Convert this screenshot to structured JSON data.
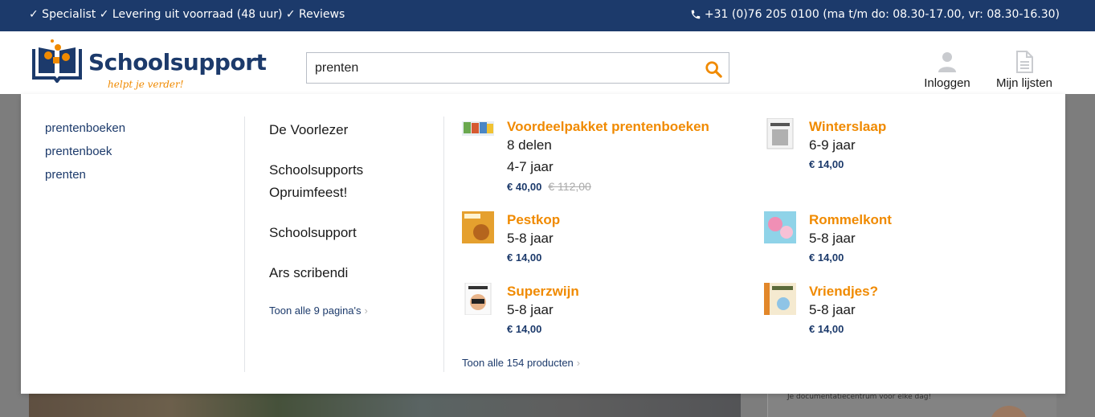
{
  "topbar": {
    "usps": "✓ Specialist ✓ Levering uit voorraad (48 uur) ✓ Reviews",
    "phone": "+31 (0)76 205 0100 (ma t/m do: 08.30-17.00, vr: 08.30-16.30)"
  },
  "header": {
    "logo_name": "Schoolsupport",
    "logo_tagline": "helpt je verder!",
    "search_value": "prenten",
    "search_icon": "search-icon",
    "login_label": "Inloggen",
    "lists_label": "Mijn lijsten"
  },
  "dropdown": {
    "suggestions": [
      "prentenboeken",
      "prentenboek",
      "prenten"
    ],
    "pages": [
      "De Voorlezer",
      "Schoolsupports Opruimfeest!",
      "Schoolsupport",
      "Ars scribendi"
    ],
    "pages_more": "Toon alle 9 pagina's",
    "products": [
      {
        "name": "Voordeelpakket prentenboeken",
        "line1": "8 delen",
        "line2": "4-7 jaar",
        "price": "€ 40,00",
        "old_price": "€ 112,00"
      },
      {
        "name": "Winterslaap",
        "line1": "6-9 jaar",
        "price": "€ 14,00"
      },
      {
        "name": "Pestkop",
        "line1": "5-8 jaar",
        "price": "€ 14,00"
      },
      {
        "name": "Rommelkont",
        "line1": "5-8 jaar",
        "price": "€ 14,00"
      },
      {
        "name": "Superzwijn",
        "line1": "5-8 jaar",
        "price": "€ 14,00"
      },
      {
        "name": "Vriendjes?",
        "line1": "5-8 jaar",
        "price": "€ 14,00"
      }
    ],
    "products_more": "Toon alle 154 producten"
  },
  "background": {
    "side_text": "Je documentatiecentrum voor elke dag!"
  },
  "colors": {
    "brand_navy": "#1c3a6b",
    "accent_orange": "#f08a00"
  }
}
